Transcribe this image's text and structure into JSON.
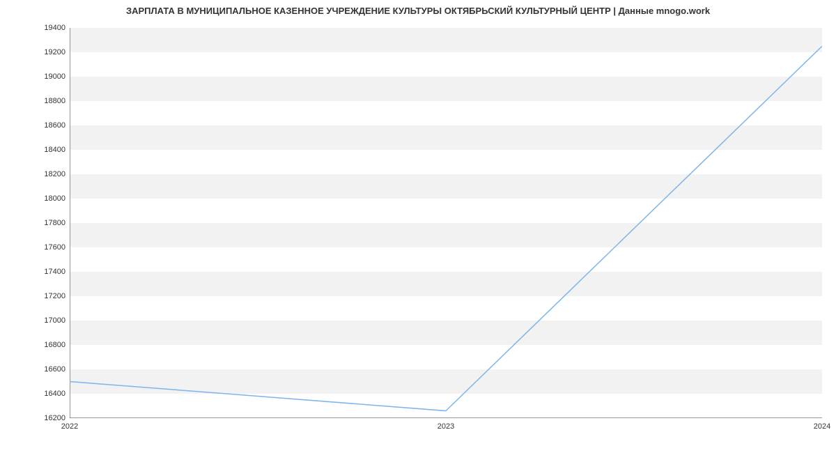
{
  "chart_data": {
    "type": "line",
    "title": "ЗАРПЛАТА В МУНИЦИПАЛЬНОЕ КАЗЕННОЕ УЧРЕЖДЕНИЕ КУЛЬТУРЫ ОКТЯБРЬСКИЙ КУЛЬТУРНЫЙ ЦЕНТР | Данные mnogo.work",
    "xlabel": "",
    "ylabel": "",
    "x": [
      2022,
      2023,
      2024
    ],
    "values": [
      16500,
      16260,
      19250
    ],
    "x_ticks": [
      2022,
      2023,
      2024
    ],
    "y_ticks": [
      16200,
      16400,
      16600,
      16800,
      17000,
      17200,
      17400,
      17600,
      17800,
      18000,
      18200,
      18400,
      18600,
      18800,
      19000,
      19200,
      19400
    ],
    "ylim": [
      16200,
      19400
    ],
    "xlim": [
      2022,
      2024
    ],
    "line_color": "#7cb5ec",
    "grid_band_color": "#f2f2f2",
    "axis_color": "#333333"
  }
}
